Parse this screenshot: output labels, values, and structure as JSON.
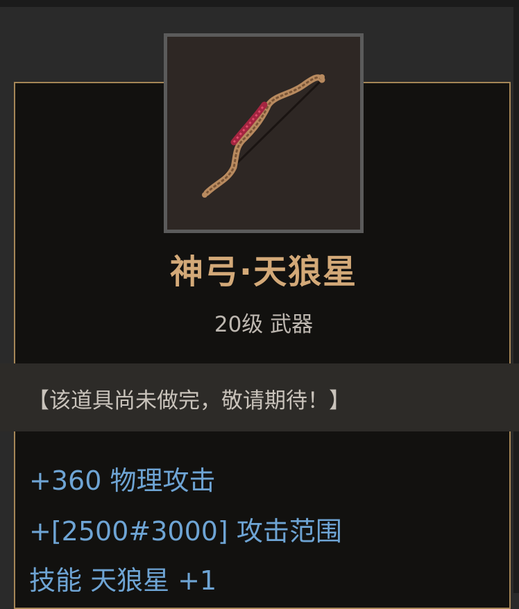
{
  "item": {
    "icon": "bow-icon",
    "name": "神弓·天狼星",
    "subtitle": "20级 武器",
    "notice": "【该道具尚未做完，敬请期待！】",
    "stats": [
      "+360 物理攻击",
      "+[2500#3000] 攻击范围",
      "技能 天狼星 +1"
    ]
  },
  "colors": {
    "name": "#d3a978",
    "stat": "#6ea4d4",
    "card_border": "#a58657"
  }
}
